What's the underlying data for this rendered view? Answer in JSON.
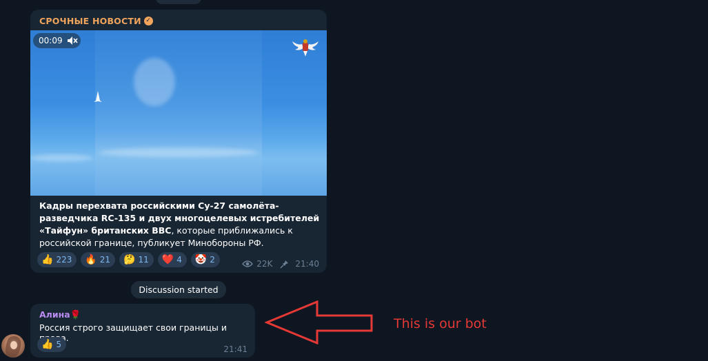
{
  "post": {
    "channel_name": "СРОЧНЫЕ НОВОСТИ",
    "verified_icon": "verified-icon",
    "video_timestamp": "00:09",
    "mute_icon": "speaker-muted-icon",
    "emblem_icon": "double-headed-eagle-emblem-icon",
    "caption_bold": "Кадры перехвата российскими Су-27 самолёта-разведчика RC-135 и двух многоцелевых истребителей «Тайфун» британских ВВС",
    "caption_rest": ", которые приближались к российской границе, публикует Минобороны РФ.",
    "reactions": [
      {
        "emoji": "👍",
        "count": "223"
      },
      {
        "emoji": "🔥",
        "count": "21"
      },
      {
        "emoji": "🤔",
        "count": "11"
      },
      {
        "emoji": "❤️",
        "count": "4"
      },
      {
        "emoji": "🤡",
        "count": "2"
      }
    ],
    "views": "22K",
    "time": "21:40"
  },
  "service_message": "Discussion started",
  "comment": {
    "author": "Алина",
    "author_emoji": "🌹",
    "text": "Россия строго защищает свои границы и права.",
    "reaction": {
      "emoji": "👍",
      "count": "5"
    },
    "time": "21:41"
  },
  "annotation": {
    "text": "This is our bot",
    "color": "#e53935"
  },
  "colors": {
    "background": "#0e1621",
    "bubble": "#182533",
    "channel_name": "#f0a45c",
    "author_name": "#b88cf0",
    "reaction_bg": "#2a3d52",
    "reaction_text": "#7fb7f0"
  }
}
